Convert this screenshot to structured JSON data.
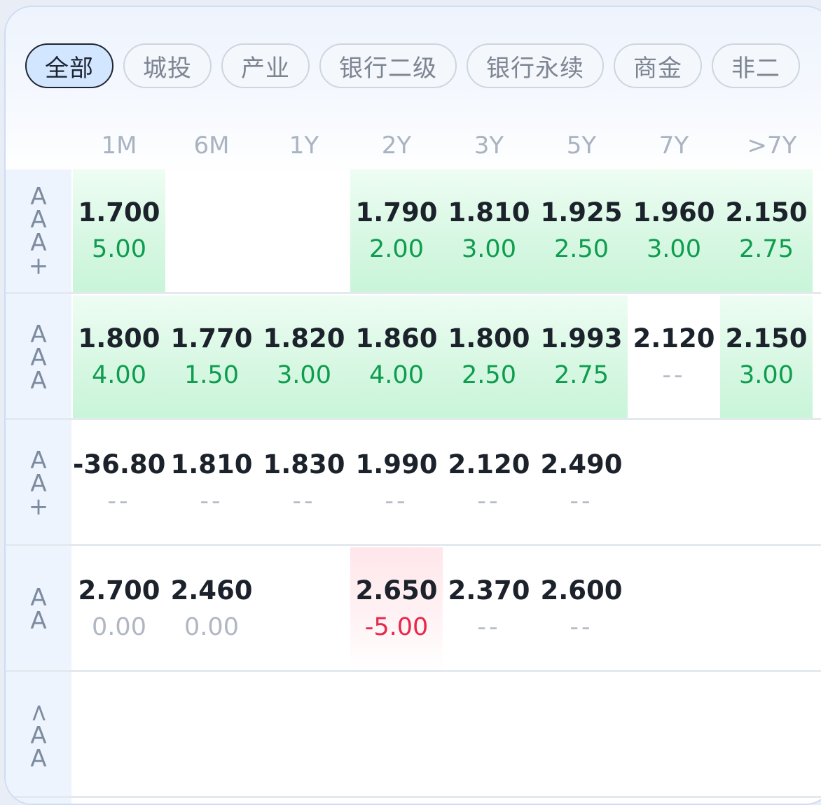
{
  "tabs": [
    "全部",
    "城投",
    "产业",
    "银行二级",
    "银行永续",
    "商金",
    "非二"
  ],
  "active_tab": "全部",
  "columns": [
    "1M",
    "6M",
    "1Y",
    "2Y",
    "3Y",
    "5Y",
    "7Y",
    ">7Y"
  ],
  "rows": [
    {
      "label": "AAA+",
      "cells": [
        {
          "yield": "1.700",
          "change": "5.00",
          "tone": "green",
          "bg": "green"
        },
        {
          "yield": "",
          "change": "",
          "tone": "",
          "bg": ""
        },
        {
          "yield": "",
          "change": "",
          "tone": "",
          "bg": ""
        },
        {
          "yield": "1.790",
          "change": "2.00",
          "tone": "green",
          "bg": "green"
        },
        {
          "yield": "1.810",
          "change": "3.00",
          "tone": "green",
          "bg": "green"
        },
        {
          "yield": "1.925",
          "change": "2.50",
          "tone": "green",
          "bg": "green"
        },
        {
          "yield": "1.960",
          "change": "3.00",
          "tone": "green",
          "bg": "green"
        },
        {
          "yield": "2.150",
          "change": "2.75",
          "tone": "green",
          "bg": "green"
        }
      ]
    },
    {
      "label": "AAA",
      "cells": [
        {
          "yield": "1.800",
          "change": "4.00",
          "tone": "green",
          "bg": "green"
        },
        {
          "yield": "1.770",
          "change": "1.50",
          "tone": "green",
          "bg": "green"
        },
        {
          "yield": "1.820",
          "change": "3.00",
          "tone": "green",
          "bg": "green"
        },
        {
          "yield": "1.860",
          "change": "4.00",
          "tone": "green",
          "bg": "green"
        },
        {
          "yield": "1.800",
          "change": "2.50",
          "tone": "green",
          "bg": "green"
        },
        {
          "yield": "1.993",
          "change": "2.75",
          "tone": "green",
          "bg": "green"
        },
        {
          "yield": "2.120",
          "change": "--",
          "tone": "dash",
          "bg": ""
        },
        {
          "yield": "2.150",
          "change": "3.00",
          "tone": "green",
          "bg": "green"
        }
      ]
    },
    {
      "label": "AA+",
      "cells": [
        {
          "yield": "-36.803",
          "change": "--",
          "tone": "dash",
          "bg": ""
        },
        {
          "yield": "1.810",
          "change": "--",
          "tone": "dash",
          "bg": ""
        },
        {
          "yield": "1.830",
          "change": "--",
          "tone": "dash",
          "bg": ""
        },
        {
          "yield": "1.990",
          "change": "--",
          "tone": "dash",
          "bg": ""
        },
        {
          "yield": "2.120",
          "change": "--",
          "tone": "dash",
          "bg": ""
        },
        {
          "yield": "2.490",
          "change": "--",
          "tone": "dash",
          "bg": ""
        },
        {
          "yield": "",
          "change": "",
          "tone": "",
          "bg": ""
        },
        {
          "yield": "",
          "change": "",
          "tone": "",
          "bg": ""
        }
      ]
    },
    {
      "label": "AA",
      "cells": [
        {
          "yield": "2.700",
          "change": "0.00",
          "tone": "grey",
          "bg": ""
        },
        {
          "yield": "2.460",
          "change": "0.00",
          "tone": "grey",
          "bg": ""
        },
        {
          "yield": "",
          "change": "",
          "tone": "",
          "bg": ""
        },
        {
          "yield": "2.650",
          "change": "-5.00",
          "tone": "red",
          "bg": "pink"
        },
        {
          "yield": "2.370",
          "change": "--",
          "tone": "dash",
          "bg": ""
        },
        {
          "yield": "2.600",
          "change": "--",
          "tone": "dash",
          "bg": ""
        },
        {
          "yield": "",
          "change": "",
          "tone": "",
          "bg": ""
        },
        {
          "yield": "",
          "change": "",
          "tone": "",
          "bg": ""
        }
      ]
    },
    {
      "label": "<AA",
      "cells": [
        {
          "yield": "",
          "change": "",
          "tone": "",
          "bg": ""
        },
        {
          "yield": "",
          "change": "",
          "tone": "",
          "bg": ""
        },
        {
          "yield": "",
          "change": "",
          "tone": "",
          "bg": ""
        },
        {
          "yield": "",
          "change": "",
          "tone": "",
          "bg": ""
        },
        {
          "yield": "",
          "change": "",
          "tone": "",
          "bg": ""
        },
        {
          "yield": "",
          "change": "",
          "tone": "",
          "bg": ""
        },
        {
          "yield": "",
          "change": "",
          "tone": "",
          "bg": ""
        },
        {
          "yield": "",
          "change": "",
          "tone": "",
          "bg": ""
        }
      ]
    }
  ],
  "colors": {
    "positive": "#0e9d4e",
    "negative": "#e8274a",
    "neutral": "#b0b7c3",
    "active_tab_bg": "#d3e6ff"
  }
}
